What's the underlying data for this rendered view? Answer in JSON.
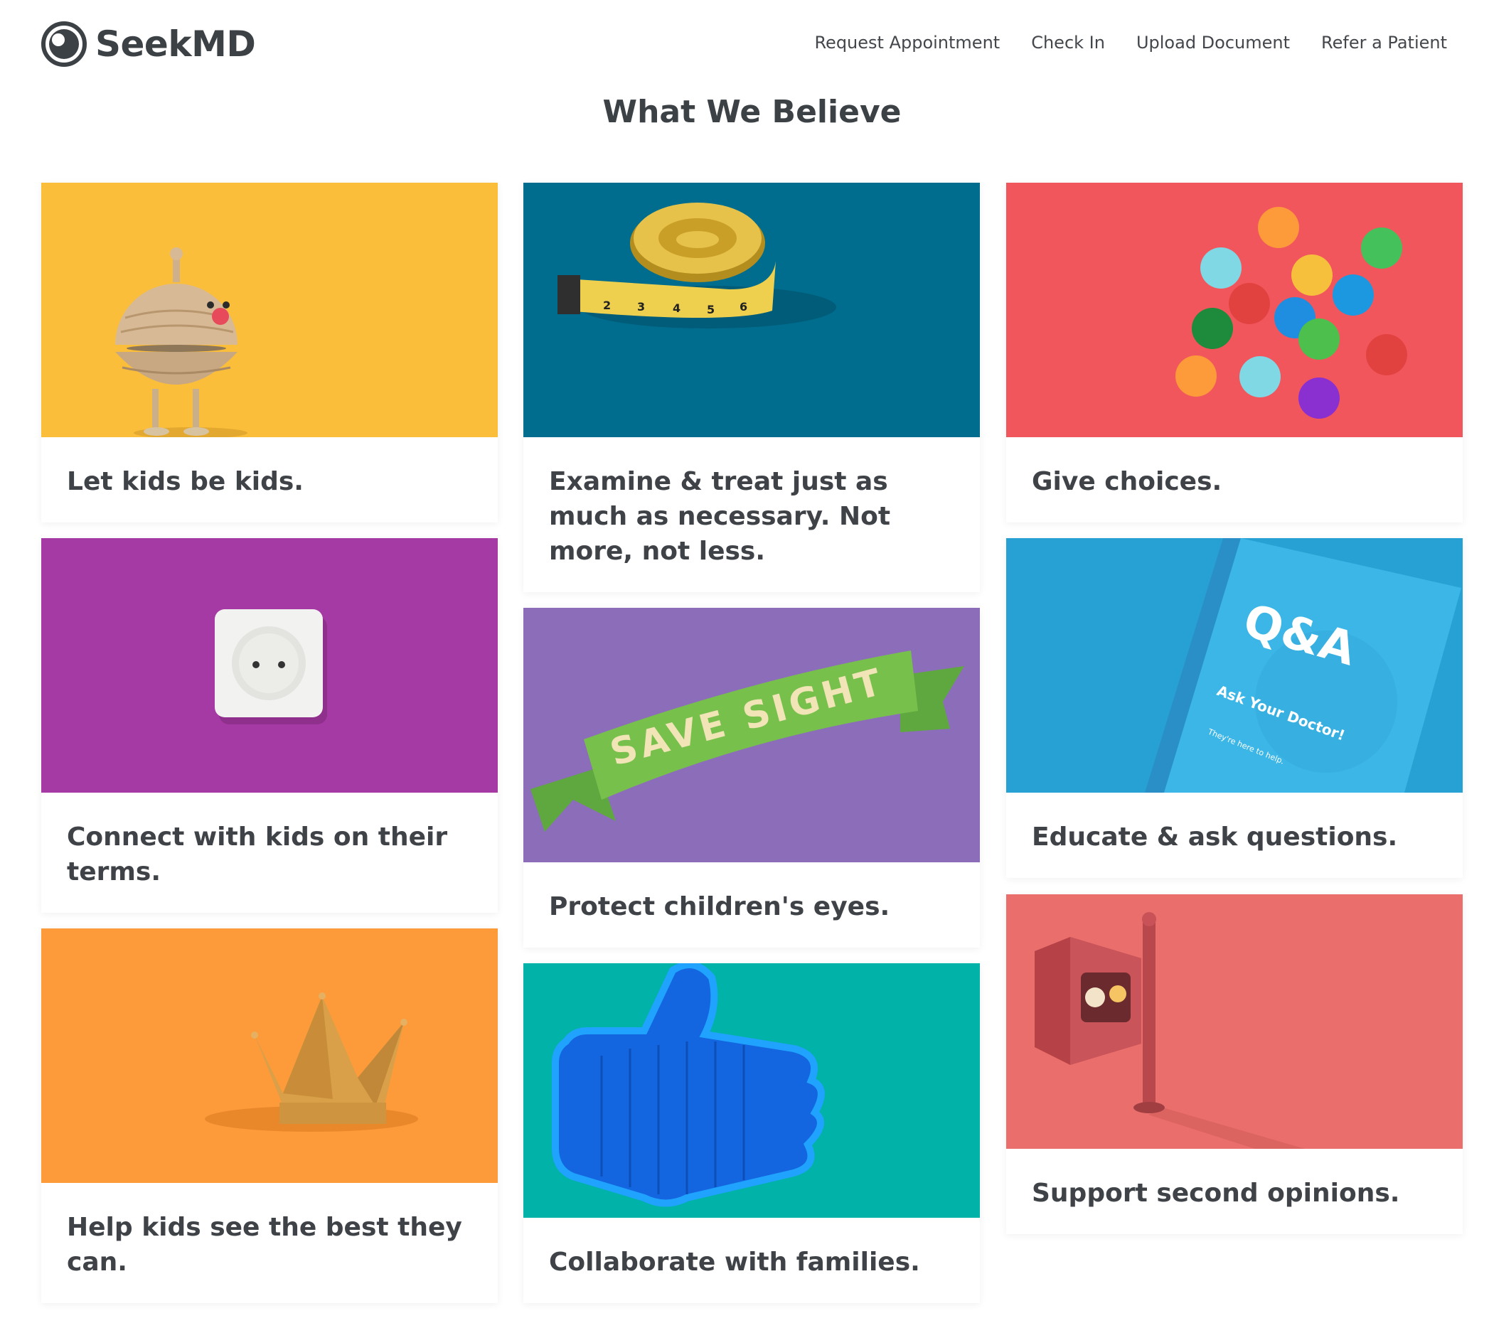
{
  "brand": {
    "name": "SeekMD"
  },
  "nav": [
    {
      "label": "Request Appointment"
    },
    {
      "label": "Check In"
    },
    {
      "label": "Upload Document"
    },
    {
      "label": "Refer a Patient"
    }
  ],
  "page": {
    "title": "What We Believe"
  },
  "cards": [
    {
      "caption": "Let kids be kids.",
      "image": "wooden-toy-figure",
      "bg": "#fbbe3b"
    },
    {
      "caption": "Connect with kids on their terms.",
      "image": "power-outlet",
      "bg": "#a63aa4"
    },
    {
      "caption": "Help kids see the best they can.",
      "image": "paper-crown",
      "bg": "#fd9a3a"
    },
    {
      "caption": "Examine & treat just as much as necessary. Not more, not less.",
      "image": "measuring-tape",
      "bg": "#006d8e"
    },
    {
      "caption": "Protect children's eyes.",
      "image": "ribbon-banner",
      "bg": "#8b6db9",
      "banner_text": "SAVE SIGHT"
    },
    {
      "caption": "Collaborate with families.",
      "image": "neon-thumbs-up",
      "bg": "#00b2a8"
    },
    {
      "caption": "Give choices.",
      "image": "colored-balls",
      "bg": "#f2565d"
    },
    {
      "caption": "Educate & ask questions.",
      "image": "qa-book",
      "bg": "#27a1d4",
      "book_title": "Q&A",
      "book_subtitle": "Ask Your Doctor!",
      "book_tagline": "They're here to help."
    },
    {
      "caption": "Support second opinions.",
      "image": "crosswalk-signal",
      "bg": "#ea6e6b"
    }
  ]
}
